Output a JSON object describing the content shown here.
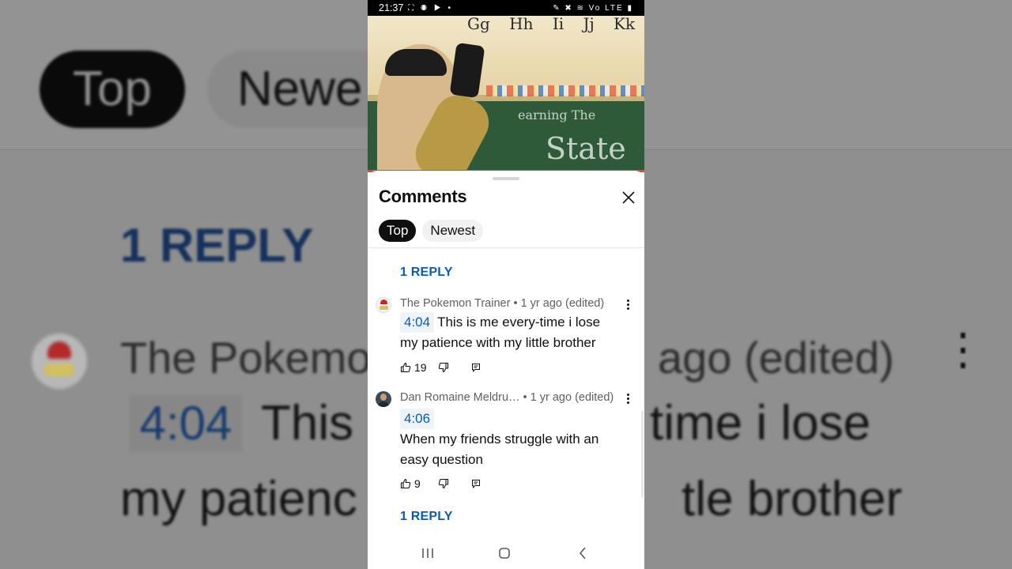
{
  "background": {
    "chip_top": "Top",
    "chip_newest": "Newe",
    "reply": "1 REPLY",
    "meta_left": "The Pokemo",
    "meta_right": "ago (edited)",
    "kebab": "⋮",
    "timestamp": "4:04",
    "line1_left": "This",
    "line1_right": "time i lose",
    "line2_left": "my patienc",
    "line2_right": "tle brother"
  },
  "status_bar": {
    "time": "21:37",
    "left_icons": "⛶ ◉ ▶ •",
    "right_icons": "✎ ✖ ≋ Vo LTE ▮"
  },
  "video": {
    "letters": "Gg Hh Ii Jj Kk",
    "chalk_line1": "earning The",
    "chalk_line2": "State"
  },
  "sheet": {
    "title": "Comments",
    "close_icon": "close-icon",
    "tabs": [
      {
        "label": "Top",
        "active": true
      },
      {
        "label": "Newest",
        "active": false
      }
    ]
  },
  "replies": [
    {
      "label": "1 REPLY"
    },
    {
      "label": "1 REPLY"
    }
  ],
  "comments": [
    {
      "author": "The Pokemon Trainer",
      "separator": "•",
      "age": "1 yr ago (edited)",
      "timestamp": "4:04",
      "text_inline": "This is me every-time i lose",
      "text_line2": "my patience with my little brother",
      "likes": "19"
    },
    {
      "author": "Dan Romaine Meldru…",
      "separator": "•",
      "age": "1 yr ago (edited)",
      "timestamp": "4:06",
      "text_line1": "When my friends struggle with an",
      "text_line2": "easy question",
      "likes": "9"
    }
  ],
  "colors": {
    "accent_link": "#0b5cad",
    "chip_active_bg": "#0f0f0f",
    "chip_inactive_bg": "#f1f1f1",
    "text_secondary": "#606060"
  }
}
